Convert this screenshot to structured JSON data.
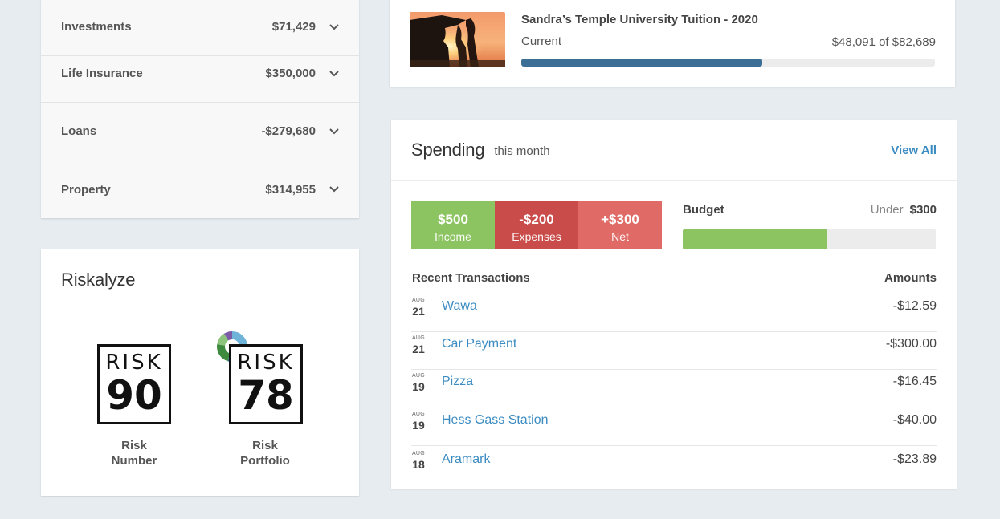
{
  "accounts": [
    {
      "name": "Investments",
      "amount": "$71,429"
    },
    {
      "name": "Life Insurance",
      "amount": "$350,000"
    },
    {
      "name": "Loans",
      "amount": "-$279,680"
    },
    {
      "name": "Property",
      "amount": "$314,955"
    }
  ],
  "riskalyze": {
    "title": "Riskalyze",
    "risk_word": "RISK",
    "number": {
      "value": "90",
      "label_line1": "Risk",
      "label_line2": "Number"
    },
    "portfolio": {
      "value": "78",
      "label_line1": "Risk",
      "label_line2": "Portfolio"
    }
  },
  "goal": {
    "title": "Sandra’s Temple University Tuition - 2020",
    "status": "Current",
    "amount_text": "$48,091 of $82,689",
    "progress_fraction": 0.5816,
    "image": "graduate-silhouette-sunset"
  },
  "spending": {
    "title": "Spending",
    "subtitle": "this month",
    "view_all": "View All",
    "summary": [
      {
        "value": "$500",
        "label": "Income",
        "color": "#8dc462"
      },
      {
        "value": "-$200",
        "label": "Expenses",
        "color": "#c94c4a"
      },
      {
        "value": "+$300",
        "label": "Net",
        "color": "#df6a66"
      }
    ],
    "budget": {
      "label": "Budget",
      "under_label": "Under",
      "under_value": "$300",
      "progress_fraction": 0.57
    },
    "recent_header": "Recent Transactions",
    "amounts_header": "Amounts",
    "transactions": [
      {
        "month": "AUG",
        "day": "21",
        "merchant": "Wawa",
        "amount": "-$12.59"
      },
      {
        "month": "AUG",
        "day": "21",
        "merchant": "Car Payment",
        "amount": "-$300.00"
      },
      {
        "month": "AUG",
        "day": "19",
        "merchant": "Pizza",
        "amount": "-$16.45"
      },
      {
        "month": "AUG",
        "day": "19",
        "merchant": "Hess Gass Station",
        "amount": "-$40.00"
      },
      {
        "month": "AUG",
        "day": "18",
        "merchant": "Aramark",
        "amount": "-$23.89"
      }
    ]
  },
  "colors": {
    "link": "#3c8cc2",
    "goal_bar": "#3b6f96",
    "budget_bar": "#8dc462",
    "background": "#e6ecef"
  },
  "icons": {
    "chevron": "chevron-down-icon",
    "portfolio_donut": "portfolio-allocation-donut-icon"
  }
}
